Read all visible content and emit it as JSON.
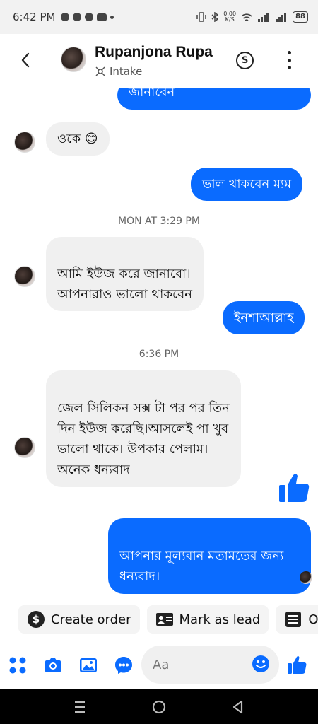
{
  "status_bar": {
    "time": "6:42 PM",
    "network_speed": "0.00\nK/S",
    "battery": "88"
  },
  "header": {
    "contact_name": "Rupanjona Rupa",
    "subtitle": "Intake",
    "back_icon": "arrow-left",
    "payment_icon": "dollar-circle",
    "menu_icon": "more-vertical"
  },
  "messages": [
    {
      "type": "outgoing",
      "text": "জানাবেন"
    },
    {
      "type": "incoming",
      "text": "ওকে 😊"
    },
    {
      "type": "outgoing",
      "text": "ভাল থাকবেন ম্যম"
    },
    {
      "type": "timestamp",
      "text": "MON AT 3:29 PM"
    },
    {
      "type": "incoming",
      "text": "আমি ইউজ করে জানাবো।\nআপনারাও ভালো থাকবেন"
    },
    {
      "type": "outgoing",
      "text": "ইনশাআল্লাহ"
    },
    {
      "type": "timestamp",
      "text": "6:36 PM"
    },
    {
      "type": "incoming",
      "text": "জেল সিলিকন সক্স টা পর পর তিন\nদিন ইউজ করেছি।আসলেই পা খুব\nভালো থাকে। উপকার পেলাম।\nঅনেক ধন্যবাদ"
    },
    {
      "type": "outgoing-like",
      "text": ""
    },
    {
      "type": "outgoing",
      "text": "আপনার মূল্যবান মতামতের জন্য\nধন্যবাদ।"
    }
  ],
  "quick_actions": [
    {
      "label": "Create order",
      "icon": "dollar-circle-icon"
    },
    {
      "label": "Mark as lead",
      "icon": "contact-card-icon"
    },
    {
      "label": "Or",
      "icon": "list-icon"
    }
  ],
  "composer": {
    "placeholder": "Aa",
    "icons": [
      "apps-grid-icon",
      "camera-icon",
      "image-icon",
      "messenger-icon",
      "emoji-icon",
      "thumbs-up-icon"
    ]
  },
  "colors": {
    "accent": "#0A6BFF",
    "incoming_bubble": "#F0F0F0",
    "text": "#111111"
  }
}
